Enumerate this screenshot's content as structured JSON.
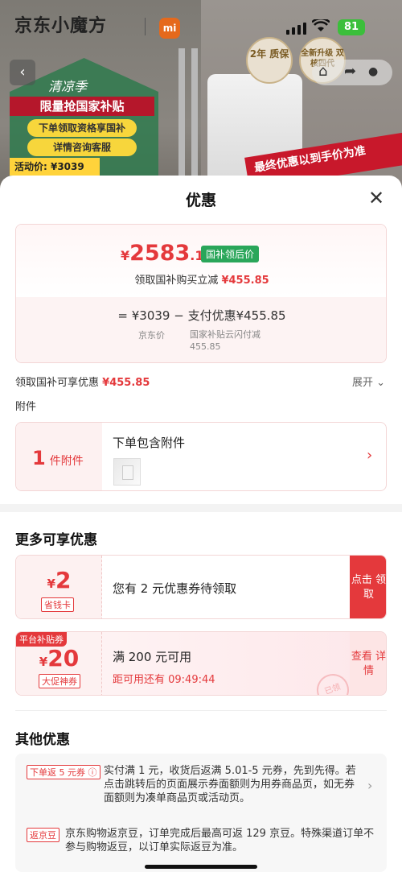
{
  "status_bar": {
    "carrier_logo_text": "京东小魔方",
    "mi_logo": "mi",
    "battery": "81"
  },
  "background": {
    "promo_season": "清凉季",
    "promo_banner": "限量抢国家补贴",
    "promo_line1": "下单领取资格享国补",
    "promo_line2": "详情咨询客服",
    "promo_price": "活动价: ¥3039",
    "badge_warranty": "2年 质保",
    "badge_upgrade": "全新升级 双核四代",
    "promo_right": "最终优惠以到手价为准"
  },
  "sheet": {
    "title": "优惠",
    "price_card": {
      "currency": "¥",
      "price_int": "2583",
      "price_dec": ".15",
      "badge": "国补领后价",
      "claim_text": "领取国补购买立减",
      "claim_amount": "¥455.85",
      "formula": "= ¥3039 − 支付优惠¥455.85",
      "sub_jd": "京东价",
      "sub_gov": "国家补贴云闪付减 455.85"
    },
    "subsidy_text": "领取国补可享优惠",
    "subsidy_amount": "¥455.85",
    "expand_label": "展开",
    "attach_label": "附件",
    "attachment": {
      "count": "1",
      "count_unit": "件附件",
      "title": "下单包含附件"
    },
    "more_title": "更多可享优惠",
    "coupons": [
      {
        "currency": "¥",
        "value": "2",
        "tag": "省钱卡",
        "desc": "您有 2 元优惠券待领取",
        "action": "点击 领取"
      },
      {
        "platform_badge": "平台补贴券",
        "currency": "¥",
        "value": "20",
        "tag": "大促神券",
        "desc": "满 200 元可用",
        "countdown": "距可用还有 09:49:44",
        "action": "查看 详情",
        "stamp": "已领"
      }
    ],
    "other_title": "其他优惠",
    "other_items": [
      {
        "tag": "下单返 5 元券",
        "text": "实付满 1 元，收货后返满 5.01-5 元券，先到先得。若点击跳转后的页面展示券面额则为用券商品页，如无券面额则为凑单商品页或活动页。"
      },
      {
        "tag": "返京豆",
        "text": "京东购物返京豆，订单完成后最高可返 129 京豆。特殊渠道订单不参与购物返豆，以订单实际返豆为准。"
      }
    ]
  },
  "colors": {
    "accent_red": "#e4393c",
    "gov_green": "#2aa65a"
  }
}
